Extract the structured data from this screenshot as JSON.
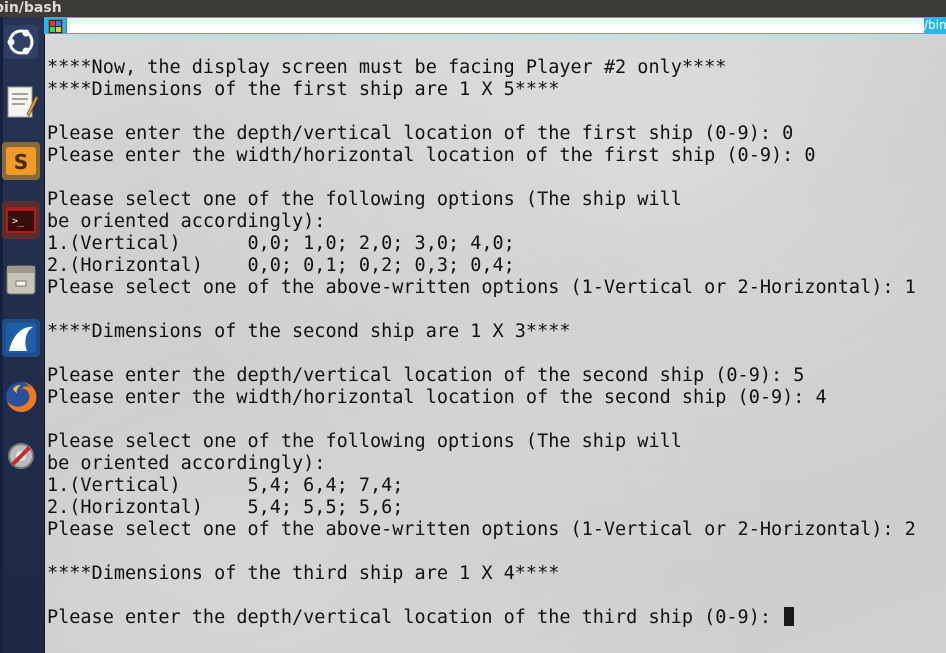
{
  "window": {
    "title": "bin/bash"
  },
  "tab": {
    "title": "/bin"
  },
  "launcher": {
    "items": [
      {
        "name": "ubuntu-dash-icon"
      },
      {
        "name": "text-editor-icon"
      },
      {
        "name": "sublime-text-icon"
      },
      {
        "name": "terminal-app-icon"
      },
      {
        "name": "files-icon"
      },
      {
        "name": "wireshark-icon"
      },
      {
        "name": "firefox-icon"
      },
      {
        "name": "system-settings-icon"
      }
    ]
  },
  "terminal": {
    "lines": [
      "****Now, the display screen must be facing Player #2 only****",
      "****Dimensions of the first ship are 1 X 5****",
      "",
      "Please enter the depth/vertical location of the first ship (0-9): 0",
      "Please enter the width/horizontal location of the first ship (0-9): 0",
      "",
      "Please select one of the following options (The ship will",
      "be oriented accordingly):",
      "1.(Vertical)      0,0; 1,0; 2,0; 3,0; 4,0;",
      "2.(Horizontal)    0,0; 0,1; 0,2; 0,3; 0,4;",
      "Please select one of the above-written options (1-Vertical or 2-Horizontal): 1",
      "",
      "****Dimensions of the second ship are 1 X 3****",
      "",
      "Please enter the depth/vertical location of the second ship (0-9): 5",
      "Please enter the width/horizontal location of the second ship (0-9): 4",
      "",
      "Please select one of the following options (The ship will",
      "be oriented accordingly):",
      "1.(Vertical)      5,4; 6,4; 7,4;",
      "2.(Horizontal)    5,4; 5,5; 5,6;",
      "Please select one of the above-written options (1-Vertical or 2-Horizontal): 2",
      "",
      "****Dimensions of the third ship are 1 X 4****",
      "",
      "Please enter the depth/vertical location of the third ship (0-9): "
    ]
  }
}
